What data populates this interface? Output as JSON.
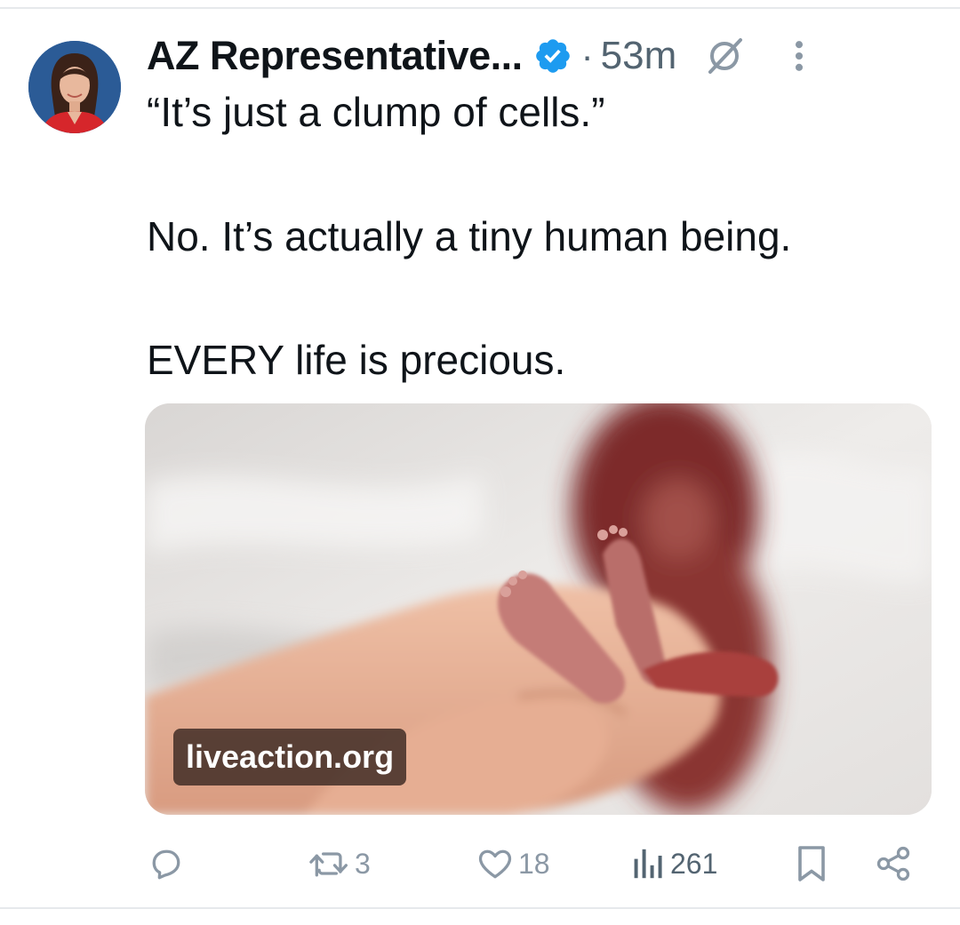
{
  "tweet": {
    "author_name": "AZ Representative...",
    "separator": "·",
    "time": "53m",
    "text_lines": [
      "“It’s just a clump of cells.”",
      "No. It’s actually a tiny human being.",
      "EVERY life is precious."
    ],
    "media": {
      "caption": "liveaction.org"
    },
    "actions": {
      "reply_count": "",
      "retweet_count": "3",
      "like_count": "18",
      "view_count": "261"
    }
  },
  "icons": {
    "verified": "verified-badge-icon",
    "grok": "grok-icon",
    "more": "more-vertical-icon",
    "reply": "reply-icon",
    "retweet": "retweet-icon",
    "like": "heart-icon",
    "views": "views-chart-icon",
    "bookmark": "bookmark-icon",
    "share": "share-icon"
  },
  "colors": {
    "accent": "#1d9bf0",
    "text_primary": "#0f1419",
    "text_secondary": "#536471",
    "icon_gray": "#8b98a5"
  }
}
